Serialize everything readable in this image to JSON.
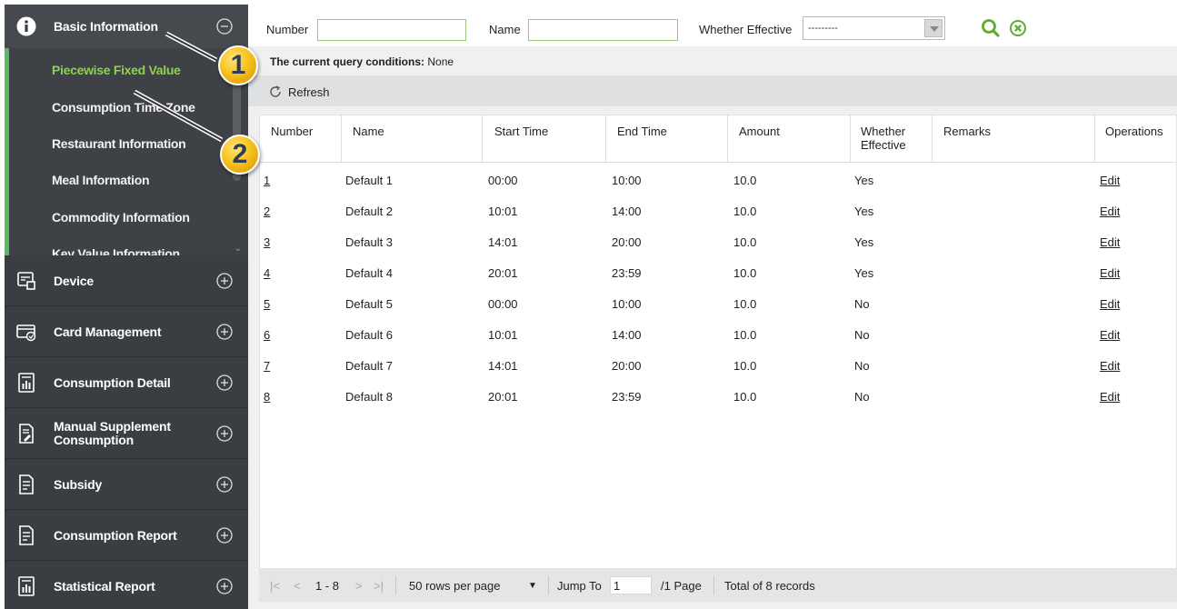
{
  "sidebar": {
    "sections": [
      {
        "title": "Basic Information",
        "icon": "info-icon",
        "state": "expanded"
      },
      {
        "title": "Device",
        "icon": "device-icon",
        "state": "collapsed"
      },
      {
        "title": "Card Management",
        "icon": "card-icon",
        "state": "collapsed"
      },
      {
        "title": "Consumption Detail",
        "icon": "report-icon",
        "state": "collapsed"
      },
      {
        "title": "Manual Supplement Consumption",
        "icon": "edit-document-icon",
        "state": "collapsed"
      },
      {
        "title": "Subsidy",
        "icon": "document-icon",
        "state": "collapsed"
      },
      {
        "title": "Consumption Report",
        "icon": "document-icon",
        "state": "collapsed"
      },
      {
        "title": "Statistical Report",
        "icon": "report-icon",
        "state": "collapsed"
      }
    ],
    "submenu": [
      {
        "label": "Piecewise Fixed Value",
        "active": true
      },
      {
        "label": "Consumption Time Zone",
        "active": false
      },
      {
        "label": "Restaurant Information",
        "active": false
      },
      {
        "label": "Meal Information",
        "active": false
      },
      {
        "label": "Commodity Information",
        "active": false
      },
      {
        "label": "Key Value Information",
        "active": false
      }
    ]
  },
  "query": {
    "number_label": "Number",
    "number_value": "",
    "name_label": "Name",
    "name_value": "",
    "effective_label": "Whether Effective",
    "effective_value": "---------",
    "search_icon": "search-icon",
    "clear_icon": "clear-icon"
  },
  "conditions": {
    "label": "The current query conditions:",
    "value": "None"
  },
  "toolbar": {
    "refresh_label": "Refresh"
  },
  "table": {
    "headers": [
      "Number",
      "Name",
      "Start Time",
      "End Time",
      "Amount",
      "Whether Effective",
      "Remarks",
      "Operations"
    ],
    "rows": [
      {
        "number": "1",
        "name": "Default 1",
        "start": "00:00",
        "end": "10:00",
        "amount": "10.0",
        "effective": "Yes",
        "remarks": "",
        "op": "Edit"
      },
      {
        "number": "2",
        "name": "Default 2",
        "start": "10:01",
        "end": "14:00",
        "amount": "10.0",
        "effective": "Yes",
        "remarks": "",
        "op": "Edit"
      },
      {
        "number": "3",
        "name": "Default 3",
        "start": "14:01",
        "end": "20:00",
        "amount": "10.0",
        "effective": "Yes",
        "remarks": "",
        "op": "Edit"
      },
      {
        "number": "4",
        "name": "Default 4",
        "start": "20:01",
        "end": "23:59",
        "amount": "10.0",
        "effective": "Yes",
        "remarks": "",
        "op": "Edit"
      },
      {
        "number": "5",
        "name": "Default 5",
        "start": "00:00",
        "end": "10:00",
        "amount": "10.0",
        "effective": "No",
        "remarks": "",
        "op": "Edit"
      },
      {
        "number": "6",
        "name": "Default 6",
        "start": "10:01",
        "end": "14:00",
        "amount": "10.0",
        "effective": "No",
        "remarks": "",
        "op": "Edit"
      },
      {
        "number": "7",
        "name": "Default 7",
        "start": "14:01",
        "end": "20:00",
        "amount": "10.0",
        "effective": "No",
        "remarks": "",
        "op": "Edit"
      },
      {
        "number": "8",
        "name": "Default 8",
        "start": "20:01",
        "end": "23:59",
        "amount": "10.0",
        "effective": "No",
        "remarks": "",
        "op": "Edit"
      }
    ]
  },
  "pager": {
    "first": "|<",
    "prev": "<",
    "range": "1 - 8",
    "next": ">",
    "last": ">|",
    "rows_per_page": "50 rows per page",
    "jump_label": "Jump To",
    "jump_value": "1",
    "page_info": "/1 Page",
    "total": "Total of 8 records"
  },
  "callouts": [
    "1",
    "2"
  ],
  "colors": {
    "accent": "#8fd14f",
    "sidebar_bg": "#3a3d42",
    "callout": "#f8c21c"
  }
}
